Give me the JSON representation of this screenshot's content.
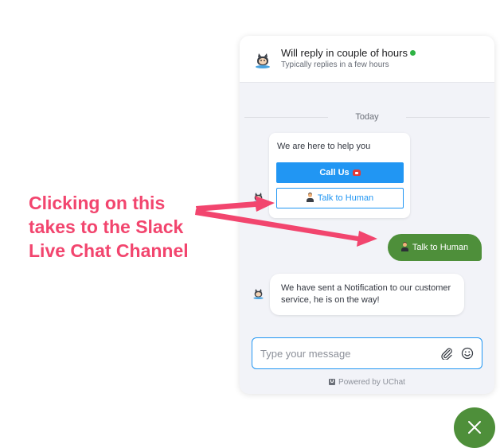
{
  "header": {
    "title": "Will reply in couple of hours",
    "subtitle": "Typically replies in a few hours",
    "status": "online"
  },
  "conversation": {
    "date_label": "Today",
    "bot_card": {
      "text": "We are here to help you",
      "call_button_label": "Call Us",
      "talk_button_label": "Talk to Human"
    },
    "user_message": "Talk to Human",
    "bot_message": "We have sent a Notification to our customer service, he is on the way!"
  },
  "composer": {
    "placeholder": "Type your message",
    "attach_icon": "paperclip-icon",
    "emoji_icon": "smiley-icon"
  },
  "footer": {
    "powered_by": "Powered by UChat"
  },
  "annotation": {
    "lines": [
      "Clicking on this",
      "takes to the Slack",
      "Live Chat Channel"
    ]
  },
  "colors": {
    "accent": "#2196f3",
    "user_bubble": "#4e8f3a",
    "online": "#2fb344",
    "annotation": "#f2456e"
  }
}
